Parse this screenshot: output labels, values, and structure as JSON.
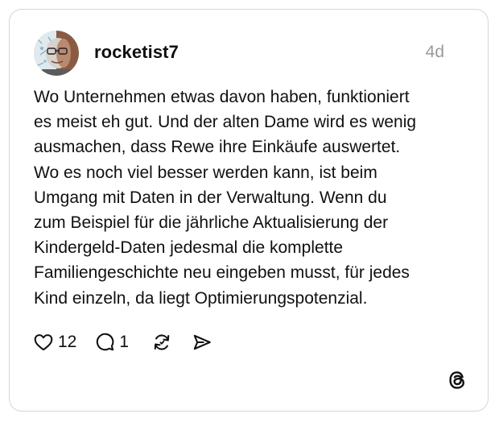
{
  "post": {
    "username": "rocketist7",
    "timestamp": "4d",
    "lines": [
      "Wo Unternehmen etwas davon haben, funktioniert",
      "es meist eh gut. Und der alten Dame wird es wenig",
      "ausmachen, dass Rewe ihre Einkäufe auswertet.",
      "Wo es noch viel besser werden kann, ist beim",
      "Umgang mit Daten in der Verwaltung. Wenn du",
      "zum Beispiel für die jährliche Aktualisierung der",
      "Kindergeld-Daten jedesmal die komplette",
      "Familiengeschichte neu eingeben musst, für jedes",
      "Kind einzeln, da liegt Optimierungspotenzial."
    ],
    "likes": "12",
    "replies": "1"
  },
  "icons": {
    "like": "heart-icon",
    "reply": "speech-bubble-icon",
    "repost": "repost-arrows-icon",
    "share": "send-icon",
    "brand": "threads-logo"
  }
}
